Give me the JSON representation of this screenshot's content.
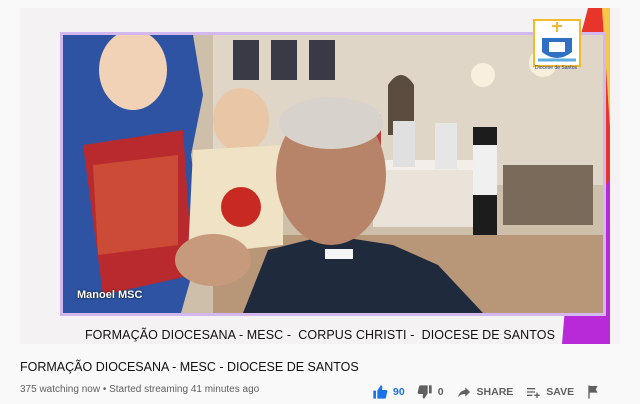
{
  "video": {
    "overlay_name": "Manoel MSC",
    "caption": "FORMAÇÃO DIOCESANA - MESC -  CORPUS CHRISTI -  DIOCESE DE SANTOS",
    "logo_text": "Diocese de Santos"
  },
  "info": {
    "title": "FORMAÇÃO DIOCESANA - MESC - DIOCESE DE SANTOS",
    "meta": "375 watching now • Started streaming 41 minutes ago"
  },
  "actions": {
    "like_count": "90",
    "dislike_count": "0",
    "share_label": "SHARE",
    "save_label": "SAVE"
  },
  "colors": {
    "accent": "#1a73e8",
    "frame_border": "#d3b7ef",
    "stripe_red": "#e8352c",
    "stripe_purple": "#b82ad8"
  }
}
